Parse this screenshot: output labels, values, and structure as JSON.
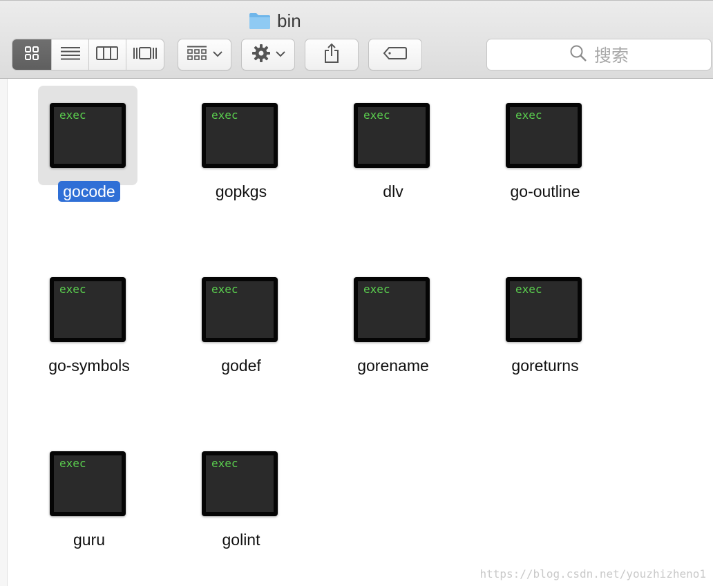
{
  "window": {
    "title": "bin",
    "title_icon": "folder-icon"
  },
  "toolbar": {
    "view_modes": [
      {
        "name": "icon-view",
        "icon": "grid-icon",
        "active": true
      },
      {
        "name": "list-view",
        "icon": "list-icon",
        "active": false
      },
      {
        "name": "column-view",
        "icon": "columns-icon",
        "active": false
      },
      {
        "name": "coverflow-view",
        "icon": "coverflow-icon",
        "active": false
      }
    ],
    "arrange_icon": "arrange-grid-icon",
    "action_icon": "gear-icon",
    "share_icon": "share-icon",
    "tag_icon": "tag-icon",
    "search": {
      "placeholder": "搜索",
      "icon": "magnifier-icon"
    }
  },
  "files": [
    {
      "name": "gocode",
      "badge": "exec",
      "selected": true
    },
    {
      "name": "gopkgs",
      "badge": "exec",
      "selected": false
    },
    {
      "name": "dlv",
      "badge": "exec",
      "selected": false
    },
    {
      "name": "go-outline",
      "badge": "exec",
      "selected": false
    },
    {
      "name": "go-symbols",
      "badge": "exec",
      "selected": false
    },
    {
      "name": "godef",
      "badge": "exec",
      "selected": false
    },
    {
      "name": "gorename",
      "badge": "exec",
      "selected": false
    },
    {
      "name": "goreturns",
      "badge": "exec",
      "selected": false
    },
    {
      "name": "guru",
      "badge": "exec",
      "selected": false
    },
    {
      "name": "golint",
      "badge": "exec",
      "selected": false
    }
  ],
  "watermark": "https://blog.csdn.net/youzhizheno1",
  "colors": {
    "selection": "#2f6fd6",
    "exec_text": "#5bd14f",
    "folder_blue": "#7fc0ef"
  }
}
